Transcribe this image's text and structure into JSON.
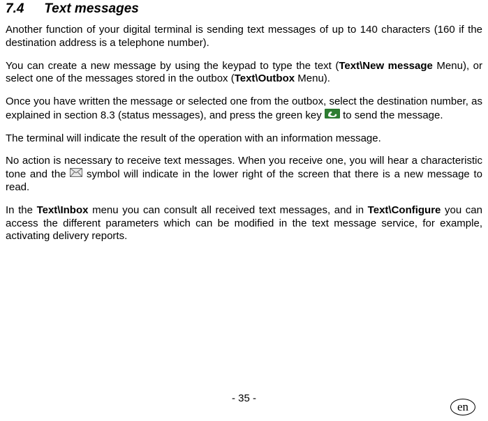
{
  "section": {
    "number": "7.4",
    "title": "Text messages"
  },
  "paragraphs": {
    "p1": "Another function of your digital terminal is sending text messages of up to 140 characters (160 if the destination address is a telephone number).",
    "p2a": "You can create a new message by using the keypad to type the text (",
    "p2b": "Text\\New message",
    "p2c": " Menu), or select one of the messages stored in the outbox (",
    "p2d": "Text\\Outbox",
    "p2e": " Menu).",
    "p3a": "Once you have written the message or selected one from the outbox, select the destination number, as explained in section 8.3 (status messages), and press the green key ",
    "p3b": " to send the message.",
    "p4": "The terminal will indicate the result of the operation with an information message.",
    "p5a": "No action is necessary to receive text messages. When you receive one, you will hear a characteristic tone and the ",
    "p5b": " symbol will indicate in the lower right of the screen that there is a new message to read.",
    "p6a": "In the ",
    "p6b": "Text\\Inbox",
    "p6c": " menu you can consult all received text messages, and in ",
    "p6d": "Text\\Configure",
    "p6e": " you can access the different parameters which can be modified in the text message service, for example, activating delivery reports."
  },
  "footer": {
    "page_number": "- 35 -",
    "language": "en"
  }
}
